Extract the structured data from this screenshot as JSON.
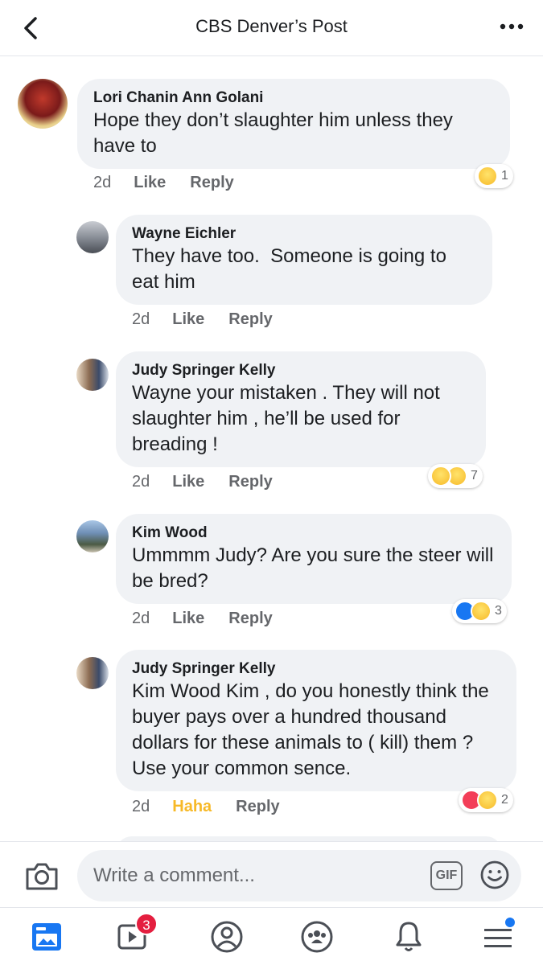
{
  "header": {
    "title": "CBS Denver’s Post"
  },
  "comments": [
    {
      "author": "Lori Chanin Ann Golani",
      "text": "Hope they don’t slaughter him unless they have to",
      "time": "2d",
      "like": "Like",
      "reply": "Reply",
      "reaction_count": "1"
    },
    {
      "author": "Wayne Eichler",
      "text": "They have too.  Someone is going to eat him",
      "time": "2d",
      "like": "Like",
      "reply": "Reply"
    },
    {
      "author": "Judy Springer Kelly",
      "text": "Wayne your mistaken . They will not slaughter him , he’ll be used for breading !",
      "time": "2d",
      "like": "Like",
      "reply": "Reply",
      "reaction_count": "7"
    },
    {
      "author": "Kim Wood",
      "text": "Ummmm Judy? Are you sure the steer will be bred?",
      "time": "2d",
      "like": "Like",
      "reply": "Reply",
      "reaction_count": "3"
    },
    {
      "author": "Judy Springer Kelly",
      "text": "Kim Wood Kim , do you honestly think the buyer pays over a hundred thousand dollars for these animals to ( kill) them ?  Use your common sence.",
      "time": "2d",
      "like": "Haha",
      "reply": "Reply",
      "reaction_count": "2"
    }
  ],
  "composer": {
    "placeholder": "Write a comment...",
    "gif_label": "GIF"
  },
  "tabbar": {
    "video_badge": "3"
  },
  "colors": {
    "accent": "#1877f2",
    "haha_active": "#f7b928",
    "badge": "#e41e3f"
  }
}
